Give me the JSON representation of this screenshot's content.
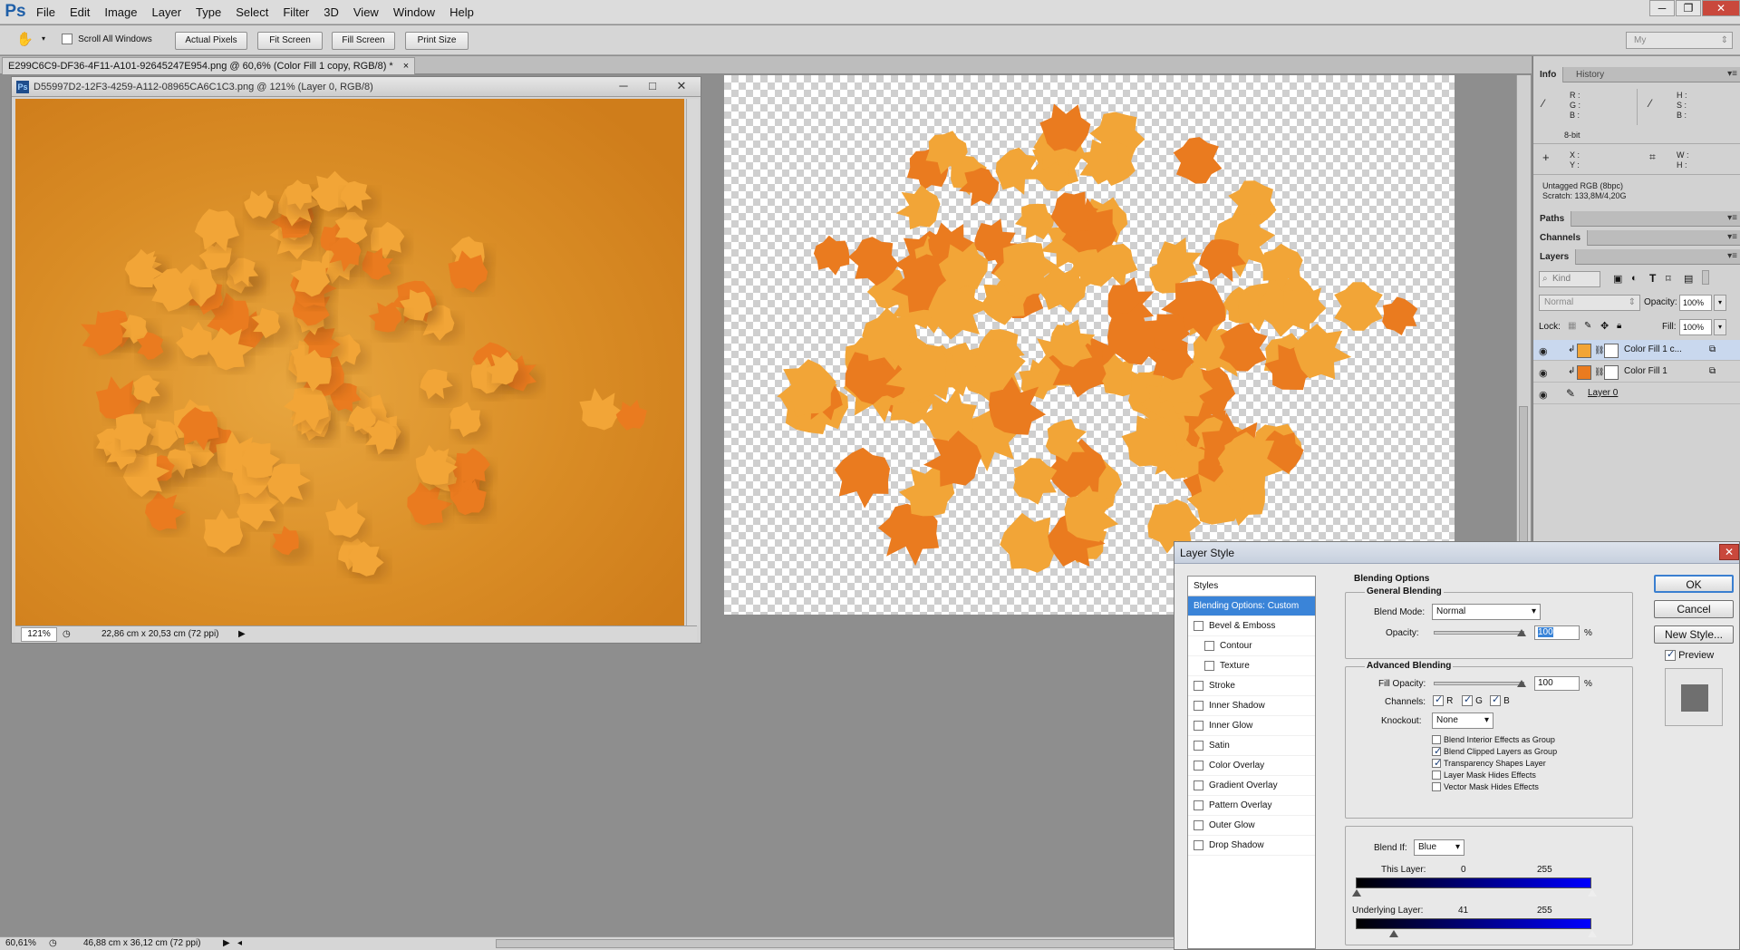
{
  "app": {
    "logo": "Ps",
    "menu": [
      "File",
      "Edit",
      "Image",
      "Layer",
      "Type",
      "Select",
      "Filter",
      "3D",
      "View",
      "Window",
      "Help"
    ],
    "window_controls": [
      "─",
      "❐",
      "✕"
    ]
  },
  "options_bar": {
    "tool_icon": "hand-tool-icon",
    "scroll_all_label": "Scroll All Windows",
    "scroll_all_checked": false,
    "buttons": [
      "Actual Pixels",
      "Fit Screen",
      "Fill Screen",
      "Print Size"
    ],
    "workspace": "My"
  },
  "document_tab": {
    "title": "E299C6C9-DF36-4F11-A101-92645247E954.png @ 60,6% (Color Fill 1 copy, RGB/8) *",
    "close": "×"
  },
  "float_window": {
    "title": "D55997D2-12F3-4259-A112-08965CA6C1C3.png @ 121% (Layer 0, RGB/8)",
    "controls": [
      "─",
      "□",
      "✕"
    ],
    "zoom": "121%",
    "doc_size": "22,86 cm x 20,53 cm (72 ppi)"
  },
  "status": {
    "zoom": "60,61%",
    "doc_size": "46,88 cm x 36,12 cm (72 ppi)"
  },
  "info_panel": {
    "tabs": [
      "Info",
      "History"
    ],
    "r": "R :",
    "g": "G :",
    "b": "B :",
    "h": "H :",
    "s": "S :",
    "b2": "B :",
    "bit": "8-bit",
    "x": "X :",
    "y": "Y :",
    "w": "W :",
    "hh": "H :",
    "profile": "Untagged RGB (8bpc)",
    "scratch": "Scratch: 133,8M/4,20G"
  },
  "panels": {
    "paths": "Paths",
    "channels": "Channels",
    "layers": "Layers"
  },
  "layers_panel": {
    "kind": "Kind",
    "blend_mode": "Normal",
    "opacity_label": "Opacity:",
    "opacity_value": "100%",
    "lock_label": "Lock:",
    "fill_label": "Fill:",
    "fill_value": "100%",
    "layers": [
      {
        "name": "Color Fill 1 c...",
        "selected": true,
        "color": "#f2a537"
      },
      {
        "name": "Color Fill 1",
        "selected": false,
        "color": "#ea7b1f"
      },
      {
        "name": "Layer 0",
        "selected": false,
        "color": "#ffffff"
      }
    ]
  },
  "layer_style": {
    "title": "Layer Style",
    "close": "✕",
    "styles_header": "Styles",
    "styles": [
      {
        "label": "Blending Options: Custom",
        "selected": true,
        "checkbox": false,
        "indent": false
      },
      {
        "label": "Bevel & Emboss",
        "checkbox": true,
        "checked": false,
        "indent": false
      },
      {
        "label": "Contour",
        "checkbox": true,
        "checked": false,
        "indent": true
      },
      {
        "label": "Texture",
        "checkbox": true,
        "checked": false,
        "indent": true
      },
      {
        "label": "Stroke",
        "checkbox": true,
        "checked": false,
        "indent": false
      },
      {
        "label": "Inner Shadow",
        "checkbox": true,
        "checked": false,
        "indent": false
      },
      {
        "label": "Inner Glow",
        "checkbox": true,
        "checked": false,
        "indent": false
      },
      {
        "label": "Satin",
        "checkbox": true,
        "checked": false,
        "indent": false
      },
      {
        "label": "Color Overlay",
        "checkbox": true,
        "checked": false,
        "indent": false
      },
      {
        "label": "Gradient Overlay",
        "checkbox": true,
        "checked": false,
        "indent": false
      },
      {
        "label": "Pattern Overlay",
        "checkbox": true,
        "checked": false,
        "indent": false
      },
      {
        "label": "Outer Glow",
        "checkbox": true,
        "checked": false,
        "indent": false
      },
      {
        "label": "Drop Shadow",
        "checkbox": true,
        "checked": false,
        "indent": false
      }
    ],
    "blending_options_title": "Blending Options",
    "general_blending": "General Blending",
    "blend_mode_label": "Blend Mode:",
    "blend_mode": "Normal",
    "opacity_label": "Opacity:",
    "opacity": "100",
    "percent": "%",
    "advanced_blending": "Advanced Blending",
    "fill_opacity_label": "Fill Opacity:",
    "fill_opacity": "100",
    "channels_label": "Channels:",
    "channels": [
      {
        "label": "R",
        "checked": true
      },
      {
        "label": "G",
        "checked": true
      },
      {
        "label": "B",
        "checked": true
      }
    ],
    "knockout_label": "Knockout:",
    "knockout": "None",
    "options": [
      {
        "label": "Blend Interior Effects as Group",
        "checked": false
      },
      {
        "label": "Blend Clipped Layers as Group",
        "checked": true
      },
      {
        "label": "Transparency Shapes Layer",
        "checked": true
      },
      {
        "label": "Layer Mask Hides Effects",
        "checked": false
      },
      {
        "label": "Vector Mask Hides Effects",
        "checked": false
      }
    ],
    "blend_if_label": "Blend If:",
    "blend_if": "Blue",
    "this_layer_label": "This Layer:",
    "this_layer_low": "0",
    "this_layer_high": "255",
    "underlying_label": "Underlying Layer:",
    "underlying_low": "41",
    "underlying_high": "255",
    "buttons": {
      "ok": "OK",
      "cancel": "Cancel",
      "new_style": "New Style..."
    },
    "preview_label": "Preview",
    "preview_checked": true
  },
  "colors": {
    "leaf_light": "#f2a537",
    "leaf_dark": "#ea7b1f",
    "selection_blue": "#3a84d8"
  }
}
